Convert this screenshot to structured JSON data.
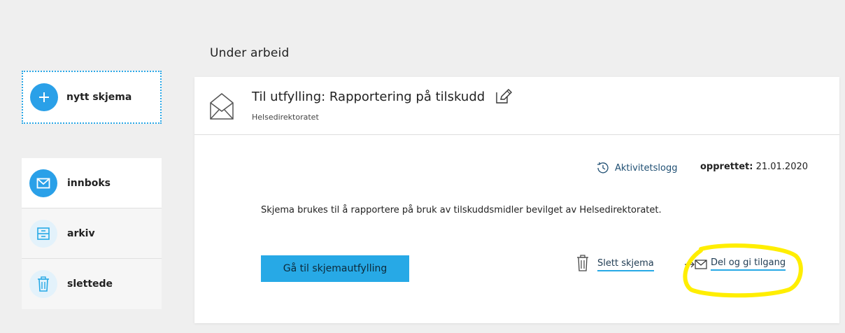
{
  "new_form": {
    "label": "nytt skjema",
    "icon": "plus-icon"
  },
  "sidebar": {
    "items": [
      {
        "label": "innboks",
        "icon": "envelope-icon",
        "active": true
      },
      {
        "label": "arkiv",
        "icon": "archive-icon",
        "active": false
      },
      {
        "label": "slettede",
        "icon": "trash-icon",
        "active": false
      }
    ]
  },
  "section": {
    "title": "Under arbeid"
  },
  "card": {
    "title": "Til utfylling: Rapportering på tilskudd",
    "sender": "Helsedirektoratet",
    "activity_log": "Aktivitetslogg",
    "created_label": "opprettet:",
    "created_date": "21.01.2020",
    "description": "Skjema brukes til å rapportere på bruk av tilskuddsmidler bevilget av Helsedirektoratet.",
    "primary_button": "Gå til skjemautfylling",
    "delete_label": "Slett skjema",
    "share_label": "Del og gi tilgang"
  },
  "colors": {
    "accent": "#27a9e6",
    "background": "#efefef",
    "highlight": "#ffee00",
    "link": "#1f3b52"
  }
}
